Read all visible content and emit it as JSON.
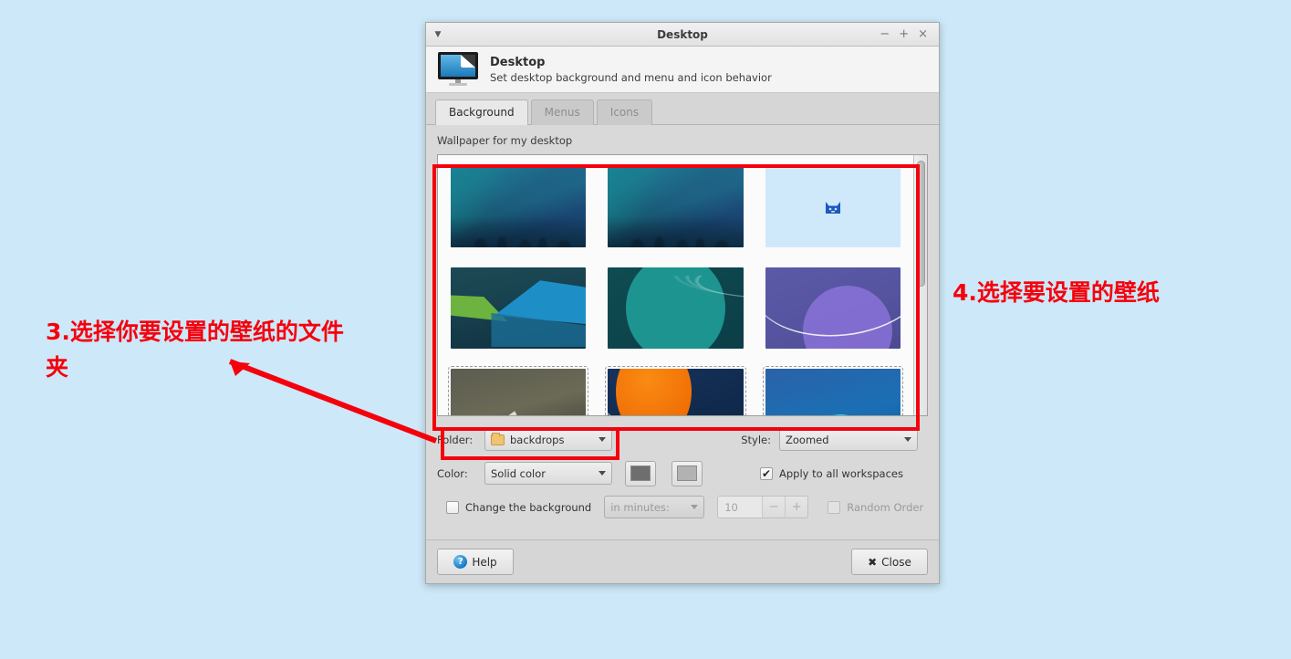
{
  "window": {
    "title": "Desktop",
    "menu_icon": "chevron-down-icon",
    "minimize_label": "−",
    "maximize_label": "+",
    "close_label": "×"
  },
  "header": {
    "icon": "desktop-monitor-icon",
    "title": "Desktop",
    "subtitle": "Set desktop background and menu and icon behavior"
  },
  "tabs": [
    {
      "label": "Background",
      "active": true
    },
    {
      "label": "Menus",
      "active": false
    },
    {
      "label": "Icons",
      "active": false
    }
  ],
  "background_tab": {
    "section_label": "Wallpaper for my desktop",
    "wallpapers": [
      {
        "name": "aurora-forest-blue",
        "style": "th-aurora"
      },
      {
        "name": "aurora-forest-blue-2",
        "style": "th-aurora"
      },
      {
        "name": "xfce-mouse-light-blue",
        "style": "th-xfce"
      },
      {
        "name": "geometric-green-blue",
        "style": "th-geo"
      },
      {
        "name": "teal-circle-waves",
        "style": "th-teal"
      },
      {
        "name": "purple-orb-streaks",
        "style": "th-purple"
      },
      {
        "name": "sand-shard-grey",
        "style": "th-sand"
      },
      {
        "name": "orange-sun-navy",
        "style": "th-orange"
      },
      {
        "name": "cyan-orb-blue",
        "style": "th-cyan"
      }
    ],
    "folder": {
      "label": "Folder:",
      "value": "backdrops",
      "icon": "folder-icon"
    },
    "style": {
      "label": "Style:",
      "value": "Zoomed"
    },
    "color": {
      "label": "Color:",
      "value": "Solid color",
      "swatch1": "#6e6e6e",
      "swatch2": "#b2b2b2"
    },
    "apply_all": {
      "label": "Apply to all workspaces",
      "checked": true,
      "check_glyph": "✔"
    },
    "change_background": {
      "label": "Change the background",
      "checked": false
    },
    "interval": {
      "value": "in minutes:"
    },
    "spinner": {
      "value": "10",
      "minus": "−",
      "plus": "+"
    },
    "random_order": {
      "label": "Random Order",
      "checked": false
    }
  },
  "footer": {
    "help_label": "Help",
    "help_glyph": "?",
    "close_label": "Close",
    "close_glyph": "✖"
  },
  "annotations": {
    "left": "3.选择你要设置的壁纸的文件夹",
    "right": "4.选择要设置的壁纸",
    "color": "#f5000d"
  }
}
